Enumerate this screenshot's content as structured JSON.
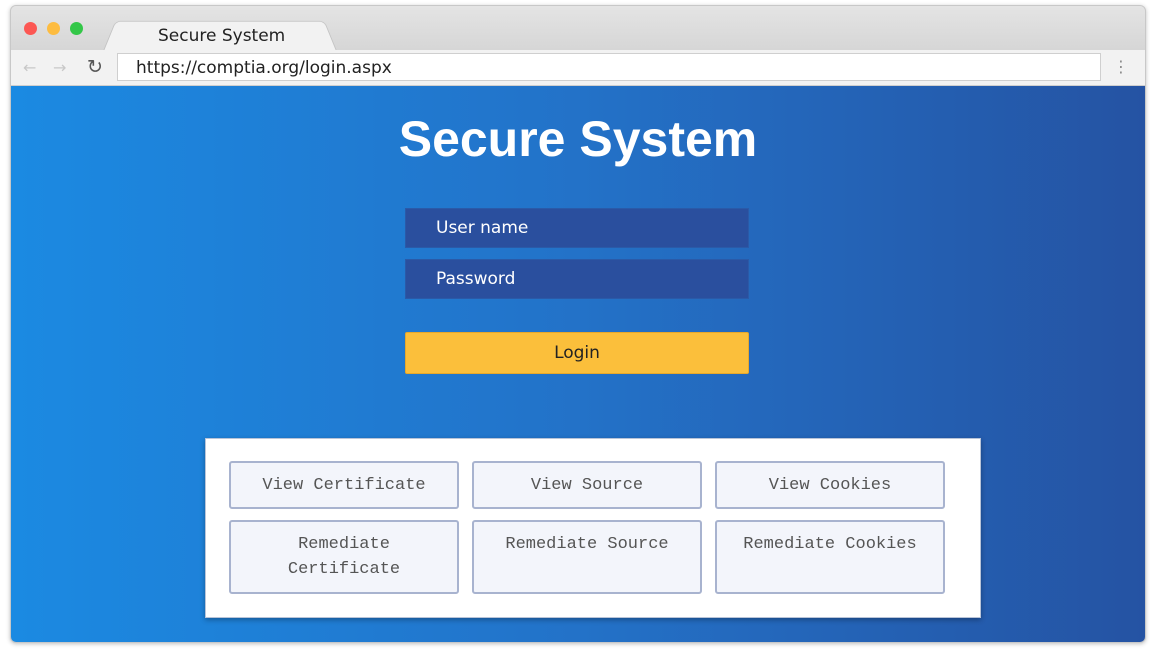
{
  "browser": {
    "tab_title": "Secure System",
    "url": "https://comptia.org/login.aspx",
    "traffic_colors": [
      "#fc5753",
      "#fdbc40",
      "#33c748"
    ]
  },
  "page": {
    "title": "Secure System",
    "username_placeholder": "User name",
    "password_placeholder": "Password",
    "login_label": "Login",
    "accent": "#fbbf3b"
  },
  "actions": [
    {
      "label": "View Certificate"
    },
    {
      "label": "View Source"
    },
    {
      "label": "View Cookies"
    },
    {
      "label": "Remediate Certificate"
    },
    {
      "label": "Remediate Source"
    },
    {
      "label": "Remediate Cookies"
    }
  ]
}
